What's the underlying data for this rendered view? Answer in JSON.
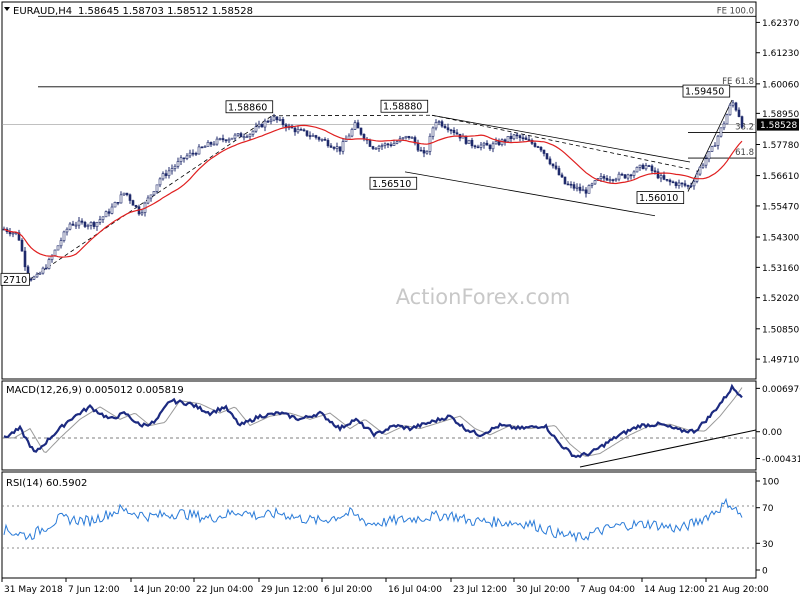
{
  "header": {
    "symbol": "EURAUD,H4",
    "ohlc": "1.58645 1.58703 1.58512 1.58528"
  },
  "watermark": "ActionForex.com",
  "chart_data": [
    {
      "type": "candlestick",
      "title": "EURAUD,H4",
      "ylim": [
        1.49,
        1.631
      ],
      "y_ticks": [
        "1.62370",
        "1.61230",
        "1.60060",
        "1.58950",
        "1.57780",
        "1.56610",
        "1.55470",
        "1.54300",
        "1.53160",
        "1.52020",
        "1.50850",
        "1.49710"
      ],
      "last_price": "1.58528",
      "fib_levels": [
        {
          "label": "FE 100.0",
          "value": 1.626
        },
        {
          "label": "FE 61.8",
          "value": 1.5995
        },
        {
          "label": "38.2",
          "value": 1.5823
        },
        {
          "label": "61.8",
          "value": 1.5727
        }
      ],
      "price_labels": [
        {
          "text": "2710",
          "value": 1.5271
        },
        {
          "text": "1.58860",
          "value": 1.5886
        },
        {
          "text": "1.58880",
          "value": 1.5888
        },
        {
          "text": "1.56510",
          "value": 1.5651
        },
        {
          "text": "1.56010",
          "value": 1.5601
        },
        {
          "text": "1.59450",
          "value": 1.5945
        }
      ],
      "series": [
        {
          "name": "price",
          "color": "#1f2a6b"
        },
        {
          "name": "moving average",
          "color": "#e02020"
        }
      ]
    },
    {
      "type": "line",
      "title": "MACD(12,26,9) 0.005012 0.005819",
      "ylim": [
        -0.006,
        0.008
      ],
      "y_ticks": [
        "0.006976",
        "0.00",
        "-0.00431"
      ],
      "series": [
        {
          "name": "MACD",
          "color": "#1c2a80"
        },
        {
          "name": "Signal",
          "color": "#9a9a9a"
        }
      ]
    },
    {
      "type": "line",
      "title": "RSI(14) 60.5902",
      "ylim": [
        0,
        100
      ],
      "y_ticks": [
        "100",
        "70",
        "30",
        "0"
      ],
      "levels": [
        70,
        30
      ],
      "series": [
        {
          "name": "RSI",
          "color": "#2a7bd8"
        }
      ]
    }
  ],
  "x_labels": [
    "31 May 2018",
    "7 Jun 12:00",
    "14 Jun 20:00",
    "22 Jun 04:00",
    "29 Jun 12:00",
    "6 Jul 20:00",
    "16 Jul 04:00",
    "23 Jul 12:00",
    "30 Jul 20:00",
    "7 Aug 04:00",
    "14 Aug 12:00",
    "21 Aug 20:00"
  ]
}
